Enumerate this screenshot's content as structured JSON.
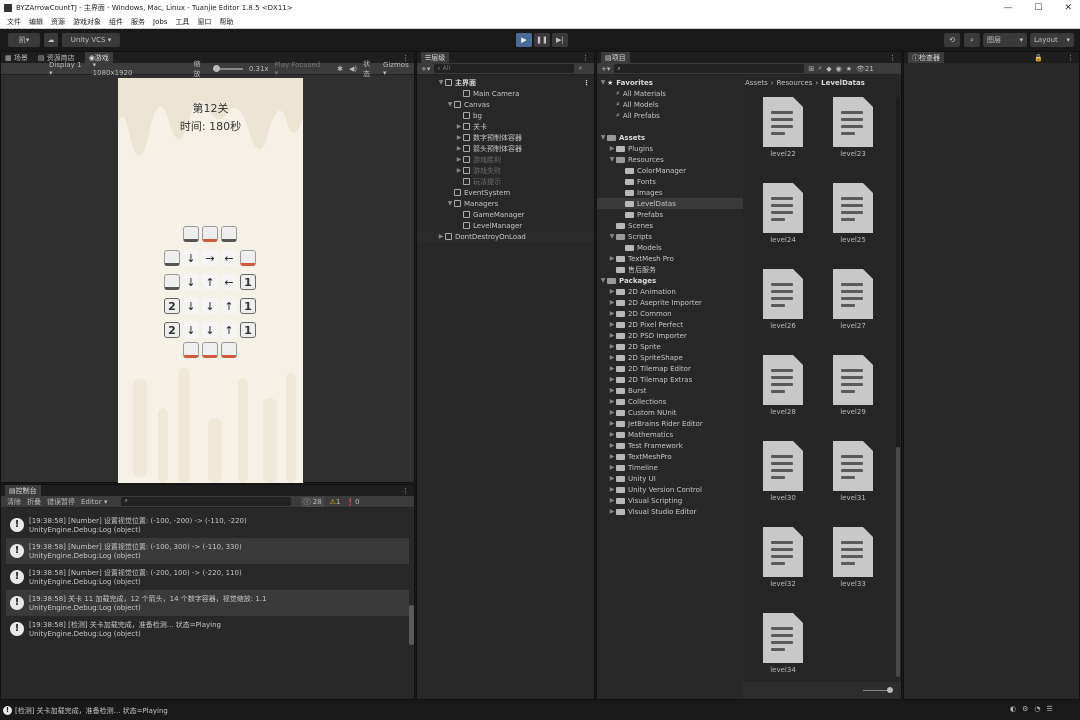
{
  "window": {
    "title": "BYZArrowCountTJ - 主界面 - Windows, Mac, Linux - Tuanjie Editor 1.8.5 <DX11>"
  },
  "menu": [
    "文件",
    "编辑",
    "资源",
    "游戏对象",
    "组件",
    "服务",
    "Jobs",
    "工具",
    "窗口",
    "帮助"
  ],
  "toolbar": {
    "account": "凯",
    "vcs": "Unity VCS",
    "layers": "图层",
    "layout": "Layout"
  },
  "scene_tabs": [
    "场景",
    "资源商店",
    "游戏"
  ],
  "game_bar": {
    "display": "Display 1",
    "resolution": "1080x1920",
    "scale_label": "缩放",
    "scale": "0.31x",
    "play_mode": "Play Focused",
    "status": "状态",
    "gizmos": "Gizmos"
  },
  "game": {
    "level_text": "第12关",
    "time_text": "时间: 180秒",
    "top_slots": [
      {
        "red": false
      },
      {
        "red": true
      },
      {
        "red": false
      }
    ],
    "grid": [
      [
        {
          "t": "slot",
          "v": "",
          "red": false
        },
        {
          "t": "arr",
          "v": "↓"
        },
        {
          "t": "arr",
          "v": "→"
        },
        {
          "t": "arr",
          "v": "←"
        },
        {
          "t": "slot",
          "v": "",
          "red": true
        }
      ],
      [
        {
          "t": "slot",
          "v": "",
          "red": false
        },
        {
          "t": "arr",
          "v": "↓"
        },
        {
          "t": "arr",
          "v": "↑"
        },
        {
          "t": "arr",
          "v": "←"
        },
        {
          "t": "num",
          "v": "1"
        }
      ],
      [
        {
          "t": "num",
          "v": "2"
        },
        {
          "t": "arr",
          "v": "↓"
        },
        {
          "t": "arr",
          "v": "↓"
        },
        {
          "t": "arr",
          "v": "↑"
        },
        {
          "t": "num",
          "v": "1"
        }
      ],
      [
        {
          "t": "num",
          "v": "2"
        },
        {
          "t": "arr",
          "v": "↓"
        },
        {
          "t": "arr",
          "v": "↓"
        },
        {
          "t": "arr",
          "v": "↑"
        },
        {
          "t": "num",
          "v": "1"
        }
      ]
    ],
    "bottom_slots": [
      {
        "red": true
      },
      {
        "red": true
      },
      {
        "red": true
      }
    ]
  },
  "hierarchy": {
    "tab": "层级",
    "search_placeholder": "All",
    "items": [
      {
        "label": "主界面",
        "indent": 0,
        "arrow": "▼",
        "icon": "cube",
        "style": "bold"
      },
      {
        "label": "Main Camera",
        "indent": 2,
        "arrow": "",
        "icon": "cube",
        "style": ""
      },
      {
        "label": "Canvas",
        "indent": 1,
        "arrow": "▼",
        "icon": "cube",
        "style": ""
      },
      {
        "label": "bg",
        "indent": 2,
        "arrow": "",
        "icon": "cube",
        "style": ""
      },
      {
        "label": "关卡",
        "indent": 2,
        "arrow": "▶",
        "icon": "cube",
        "style": ""
      },
      {
        "label": "数字预制体容器",
        "indent": 2,
        "arrow": "▶",
        "icon": "cube",
        "style": ""
      },
      {
        "label": "箭头预制体容器",
        "indent": 2,
        "arrow": "▶",
        "icon": "cube",
        "style": ""
      },
      {
        "label": "游戏胜利",
        "indent": 2,
        "arrow": "▶",
        "icon": "cube",
        "style": "dim"
      },
      {
        "label": "游戏失败",
        "indent": 2,
        "arrow": "▶",
        "icon": "cube",
        "style": "dim"
      },
      {
        "label": "玩法提示",
        "indent": 2,
        "arrow": "",
        "icon": "cube",
        "style": "dim"
      },
      {
        "label": "EventSystem",
        "indent": 1,
        "arrow": "",
        "icon": "cube",
        "style": ""
      },
      {
        "label": "Managers",
        "indent": 1,
        "arrow": "▼",
        "icon": "cube",
        "style": ""
      },
      {
        "label": "GameManager",
        "indent": 2,
        "arrow": "",
        "icon": "cube",
        "style": ""
      },
      {
        "label": "LevelManager",
        "indent": 2,
        "arrow": "",
        "icon": "cube",
        "style": ""
      },
      {
        "label": "DontDestroyOnLoad",
        "indent": 0,
        "arrow": "▶",
        "icon": "cube",
        "style": ""
      }
    ]
  },
  "project": {
    "tab": "项目",
    "count": "21",
    "breadcrumb": [
      "Assets",
      "Resources",
      "LevelDatas"
    ],
    "tree": [
      {
        "label": "Favorites",
        "indent": 0,
        "arrow": "▼",
        "icon": "star",
        "head": true
      },
      {
        "label": "All Materials",
        "indent": 1,
        "arrow": "",
        "icon": "search",
        "head": false
      },
      {
        "label": "All Models",
        "indent": 1,
        "arrow": "",
        "icon": "search",
        "head": false
      },
      {
        "label": "All Prefabs",
        "indent": 1,
        "arrow": "",
        "icon": "search",
        "head": false
      },
      {
        "label": "",
        "indent": 0,
        "arrow": "",
        "icon": "",
        "head": false
      },
      {
        "label": "Assets",
        "indent": 0,
        "arrow": "▼",
        "icon": "folder",
        "head": true
      },
      {
        "label": "Plugins",
        "indent": 1,
        "arrow": "▶",
        "icon": "folder",
        "head": false
      },
      {
        "label": "Resources",
        "indent": 1,
        "arrow": "▼",
        "icon": "folder",
        "head": false
      },
      {
        "label": "ColorManager",
        "indent": 2,
        "arrow": "",
        "icon": "folder",
        "head": false
      },
      {
        "label": "Fonts",
        "indent": 2,
        "arrow": "",
        "icon": "folder",
        "head": false
      },
      {
        "label": "Images",
        "indent": 2,
        "arrow": "",
        "icon": "folder",
        "head": false
      },
      {
        "label": "LevelDatas",
        "indent": 2,
        "arrow": "",
        "icon": "folder",
        "head": false,
        "sel": true
      },
      {
        "label": "Prefabs",
        "indent": 2,
        "arrow": "",
        "icon": "folder",
        "head": false
      },
      {
        "label": "Scenes",
        "indent": 1,
        "arrow": "",
        "icon": "folder",
        "head": false
      },
      {
        "label": "Scripts",
        "indent": 1,
        "arrow": "▼",
        "icon": "folder",
        "head": false
      },
      {
        "label": "Models",
        "indent": 2,
        "arrow": "",
        "icon": "folder",
        "head": false
      },
      {
        "label": "TextMesh Pro",
        "indent": 1,
        "arrow": "▶",
        "icon": "folder",
        "head": false
      },
      {
        "label": "售后服务",
        "indent": 1,
        "arrow": "",
        "icon": "folder",
        "head": false
      },
      {
        "label": "Packages",
        "indent": 0,
        "arrow": "▼",
        "icon": "folder",
        "head": true
      },
      {
        "label": "2D Animation",
        "indent": 1,
        "arrow": "▶",
        "icon": "folder",
        "head": false
      },
      {
        "label": "2D Aseprite Importer",
        "indent": 1,
        "arrow": "▶",
        "icon": "folder",
        "head": false
      },
      {
        "label": "2D Common",
        "indent": 1,
        "arrow": "▶",
        "icon": "folder",
        "head": false
      },
      {
        "label": "2D Pixel Perfect",
        "indent": 1,
        "arrow": "▶",
        "icon": "folder",
        "head": false
      },
      {
        "label": "2D PSD Importer",
        "indent": 1,
        "arrow": "▶",
        "icon": "folder",
        "head": false
      },
      {
        "label": "2D Sprite",
        "indent": 1,
        "arrow": "▶",
        "icon": "folder",
        "head": false
      },
      {
        "label": "2D SpriteShape",
        "indent": 1,
        "arrow": "▶",
        "icon": "folder",
        "head": false
      },
      {
        "label": "2D Tilemap Editor",
        "indent": 1,
        "arrow": "▶",
        "icon": "folder",
        "head": false
      },
      {
        "label": "2D Tilemap Extras",
        "indent": 1,
        "arrow": "▶",
        "icon": "folder",
        "head": false
      },
      {
        "label": "Burst",
        "indent": 1,
        "arrow": "▶",
        "icon": "folder",
        "head": false
      },
      {
        "label": "Collections",
        "indent": 1,
        "arrow": "▶",
        "icon": "folder",
        "head": false
      },
      {
        "label": "Custom NUnit",
        "indent": 1,
        "arrow": "▶",
        "icon": "folder",
        "head": false
      },
      {
        "label": "JetBrains Rider Editor",
        "indent": 1,
        "arrow": "▶",
        "icon": "folder",
        "head": false
      },
      {
        "label": "Mathematics",
        "indent": 1,
        "arrow": "▶",
        "icon": "folder",
        "head": false
      },
      {
        "label": "Test Framework",
        "indent": 1,
        "arrow": "▶",
        "icon": "folder",
        "head": false
      },
      {
        "label": "TextMeshPro",
        "indent": 1,
        "arrow": "▶",
        "icon": "folder",
        "head": false
      },
      {
        "label": "Timeline",
        "indent": 1,
        "arrow": "▶",
        "icon": "folder",
        "head": false
      },
      {
        "label": "Unity UI",
        "indent": 1,
        "arrow": "▶",
        "icon": "folder",
        "head": false
      },
      {
        "label": "Unity Version Control",
        "indent": 1,
        "arrow": "▶",
        "icon": "folder",
        "head": false
      },
      {
        "label": "Visual Scripting",
        "indent": 1,
        "arrow": "▶",
        "icon": "folder",
        "head": false
      },
      {
        "label": "Visual Studio Editor",
        "indent": 1,
        "arrow": "▶",
        "icon": "folder",
        "head": false
      }
    ],
    "files": [
      "level22",
      "level23",
      "level24",
      "level25",
      "level26",
      "level27",
      "level28",
      "level29",
      "level30",
      "level31",
      "level32",
      "level33",
      "level34"
    ]
  },
  "inspector": {
    "tab": "检查器"
  },
  "console": {
    "tab": "控制台",
    "buttons": [
      "清除",
      "折叠",
      "错误暂停",
      "Editor ▾"
    ],
    "counts": {
      "info": "28",
      "warn": "1",
      "error": "0"
    },
    "logs": [
      {
        "line1": "[19:38:58] [Number] 设置视觉位置: (-100, -200) -> (-110, -220)",
        "line2": "UnityEngine.Debug:Log (object)"
      },
      {
        "line1": "[19:38:58] [Number] 设置视觉位置: (-100, 300) -> (-110, 330)",
        "line2": "UnityEngine.Debug:Log (object)"
      },
      {
        "line1": "[19:38:58] [Number] 设置视觉位置: (-200, 100) -> (-220, 110)",
        "line2": "UnityEngine.Debug:Log (object)"
      },
      {
        "line1": "[19:38:58] 关卡 11 加载完成，12 个箭头，14 个数字容器，视觉缩放: 1.1",
        "line2": "UnityEngine.Debug:Log (object)"
      },
      {
        "line1": "[19:38:58] [检测] 关卡加载完成，准备检测... 状态=Playing",
        "line2": "UnityEngine.Debug:Log (object)"
      }
    ]
  },
  "status": {
    "text": "[检测] 关卡加载完成，准备检测... 状态=Playing"
  }
}
